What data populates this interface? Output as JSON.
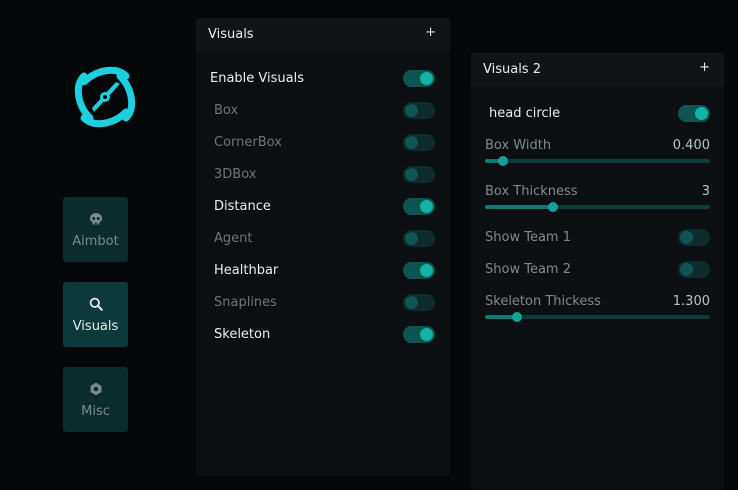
{
  "sidebar": {
    "logo_icon": "atom-logo-icon",
    "accent": "#1ecfe0",
    "items": [
      {
        "label": "Aimbot",
        "icon": "skull-icon",
        "active": false
      },
      {
        "label": "Visuals",
        "icon": "search-icon",
        "active": true
      },
      {
        "label": "Misc",
        "icon": "hexagon-nut-icon",
        "active": false
      }
    ]
  },
  "visuals_panel": {
    "title": "Visuals",
    "plus": "+",
    "toggles": [
      {
        "label": "Enable Visuals",
        "on": true
      },
      {
        "label": "Box",
        "on": false
      },
      {
        "label": "CornerBox",
        "on": false
      },
      {
        "label": "3DBox",
        "on": false
      },
      {
        "label": "Distance",
        "on": true
      },
      {
        "label": "Agent",
        "on": false
      },
      {
        "label": "Healthbar",
        "on": true
      },
      {
        "label": "Snaplines",
        "on": false
      },
      {
        "label": "Skeleton",
        "on": true
      }
    ]
  },
  "visuals2_panel": {
    "title": "Visuals 2",
    "plus": "+",
    "head_circle": {
      "label": "head circle",
      "on": true
    },
    "box_width": {
      "label": "Box Width",
      "value": "0.400",
      "fraction": 0.08
    },
    "box_thickness": {
      "label": "Box Thickness",
      "value": "3",
      "fraction": 0.3
    },
    "show_team_1": {
      "label": "Show Team 1",
      "on": false
    },
    "show_team_2": {
      "label": "Show Team 2",
      "on": false
    },
    "skeleton_thickess": {
      "label": "Skeleton Thickess",
      "value": "1.300",
      "fraction": 0.14
    }
  },
  "colors": {
    "accent": "#14b3a6",
    "toggle_on_track": "#0f5452",
    "toggle_off_track": "#0c2c2d",
    "panel_bg": "#0c0f11",
    "sidebar_button_bg": "#0a2c2d"
  }
}
